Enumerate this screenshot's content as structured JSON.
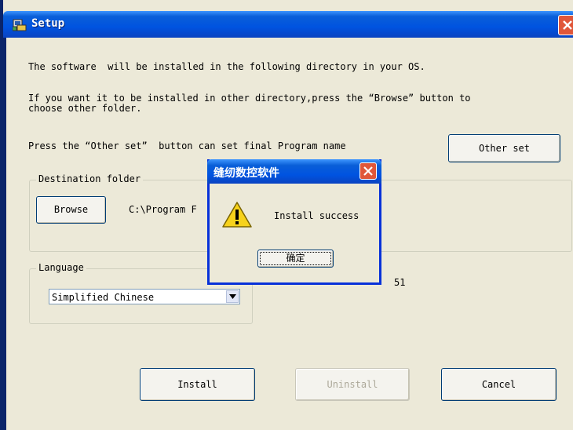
{
  "window": {
    "title": "Setup",
    "app_icon": "setup-app-icon",
    "close_icon": "close-icon"
  },
  "body": {
    "line1": "The software  will be installed in the following directory in your OS.",
    "line2a": "If you want it to be installed in other directory,press the “Browse” button to",
    "line2b": "choose other folder.",
    "line3": "Press the “Other set”  button can set final Program name",
    "other_set_label": "Other set"
  },
  "destination": {
    "legend": "Destination folder",
    "browse_label": "Browse",
    "path": "C:\\Program F"
  },
  "language": {
    "legend": "Language",
    "selected": "Simplified Chinese",
    "trailing_text": "51"
  },
  "actions": {
    "install_label": "Install",
    "uninstall_label": "Uninstall",
    "cancel_label": "Cancel"
  },
  "dialog": {
    "title": "缝纫数控软件",
    "message": "Install success",
    "ok_label": "确定",
    "icon": "warning-icon"
  },
  "colors": {
    "titlebar": "#0a5fd8",
    "window_bg": "#ece9d8",
    "close_button": "#e0573a"
  }
}
